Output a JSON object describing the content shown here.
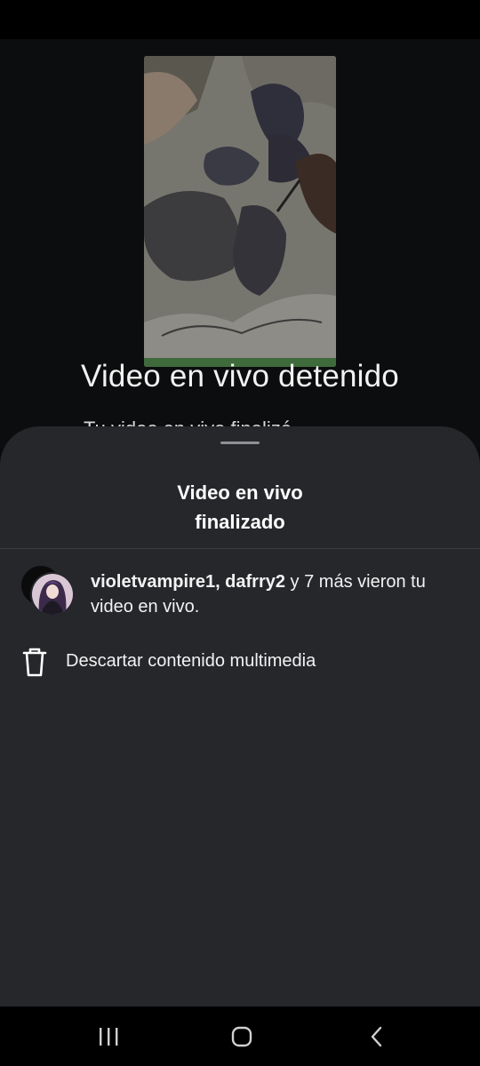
{
  "background": {
    "title": "Video en vivo detenido",
    "subtitle": "Tu video en vivo finalizó"
  },
  "sheet": {
    "title_line1": "Video en vivo",
    "title_line2": "finalizado",
    "viewers": {
      "usernames": "violetvampire1, dafrry2",
      "rest": " y 7 más vieron tu video en vivo."
    },
    "discard_label": "Descartar contenido multimedia"
  },
  "icons": {
    "trash": "trash-icon",
    "recents": "recents-icon",
    "home": "home-icon",
    "back": "back-icon"
  },
  "colors": {
    "sheet_bg": "#25272b",
    "backdrop_bg": "#0c0d0e",
    "text": "#ffffff"
  }
}
